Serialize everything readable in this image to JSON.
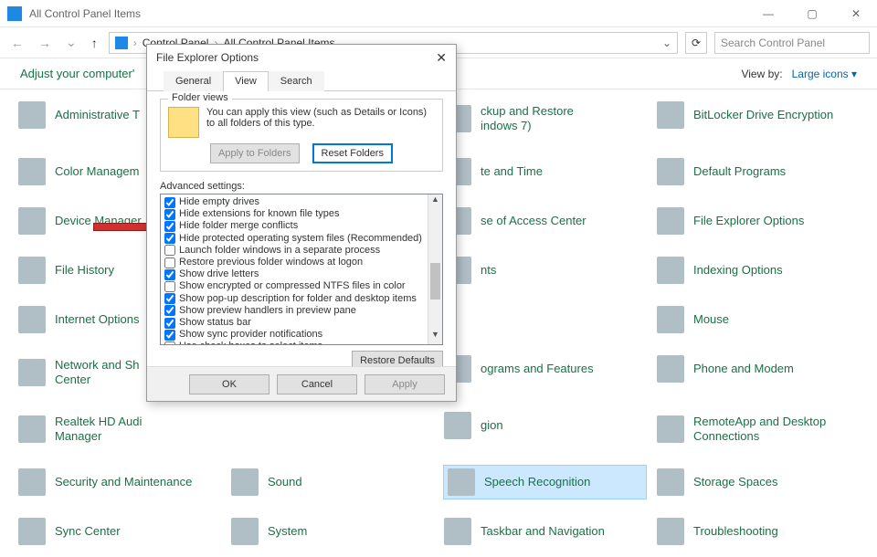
{
  "window": {
    "title": "All Control Panel Items"
  },
  "breadcrumb": {
    "a": "Control Panel",
    "b": "All Control Panel Items"
  },
  "search": {
    "placeholder": "Search Control Panel"
  },
  "subheader": {
    "text": "Adjust your computer'",
    "viewby_label": "View by:",
    "viewby_value": "Large icons"
  },
  "items": {
    "c0": [
      "Administrative T",
      "Color Managem",
      "Device Manager",
      "File History",
      "Internet Options",
      "Network and Sh\nCenter",
      "Realtek HD Audi\nManager",
      "Security and Maintenance",
      "Sync Center"
    ],
    "c1": [
      "",
      "",
      "",
      "",
      "",
      "",
      "",
      "Sound",
      "System"
    ],
    "c2": [
      "ckup and Restore\nindows 7)",
      "te and Time",
      "se of Access Center",
      "nts",
      "",
      "ograms and Features",
      "gion",
      "Speech Recognition",
      "Taskbar and Navigation"
    ],
    "c3": [
      "BitLocker Drive Encryption",
      "Default Programs",
      "File Explorer Options",
      "Indexing Options",
      "Mouse",
      "Phone and Modem",
      "RemoteApp and Desktop\nConnections",
      "Storage Spaces",
      "Troubleshooting"
    ]
  },
  "dialog": {
    "title": "File Explorer Options",
    "tabs": {
      "general": "General",
      "view": "View",
      "search": "Search"
    },
    "folder_views": {
      "legend": "Folder views",
      "text": "You can apply this view (such as Details or Icons) to all folders of this type.",
      "apply": "Apply to Folders",
      "reset": "Reset Folders"
    },
    "advanced_label": "Advanced settings:",
    "advanced": [
      {
        "c": true,
        "t": "Hide empty drives"
      },
      {
        "c": true,
        "t": "Hide extensions for known file types"
      },
      {
        "c": true,
        "t": "Hide folder merge conflicts"
      },
      {
        "c": true,
        "t": "Hide protected operating system files (Recommended)"
      },
      {
        "c": false,
        "t": "Launch folder windows in a separate process"
      },
      {
        "c": false,
        "t": "Restore previous folder windows at logon"
      },
      {
        "c": true,
        "t": "Show drive letters"
      },
      {
        "c": false,
        "t": "Show encrypted or compressed NTFS files in color"
      },
      {
        "c": true,
        "t": "Show pop-up description for folder and desktop items"
      },
      {
        "c": true,
        "t": "Show preview handlers in preview pane"
      },
      {
        "c": true,
        "t": "Show status bar"
      },
      {
        "c": true,
        "t": "Show sync provider notifications"
      },
      {
        "c": false,
        "t": "Use check boxes to select items"
      }
    ],
    "restore": "Restore Defaults",
    "ok": "OK",
    "cancel": "Cancel",
    "apply": "Apply"
  }
}
